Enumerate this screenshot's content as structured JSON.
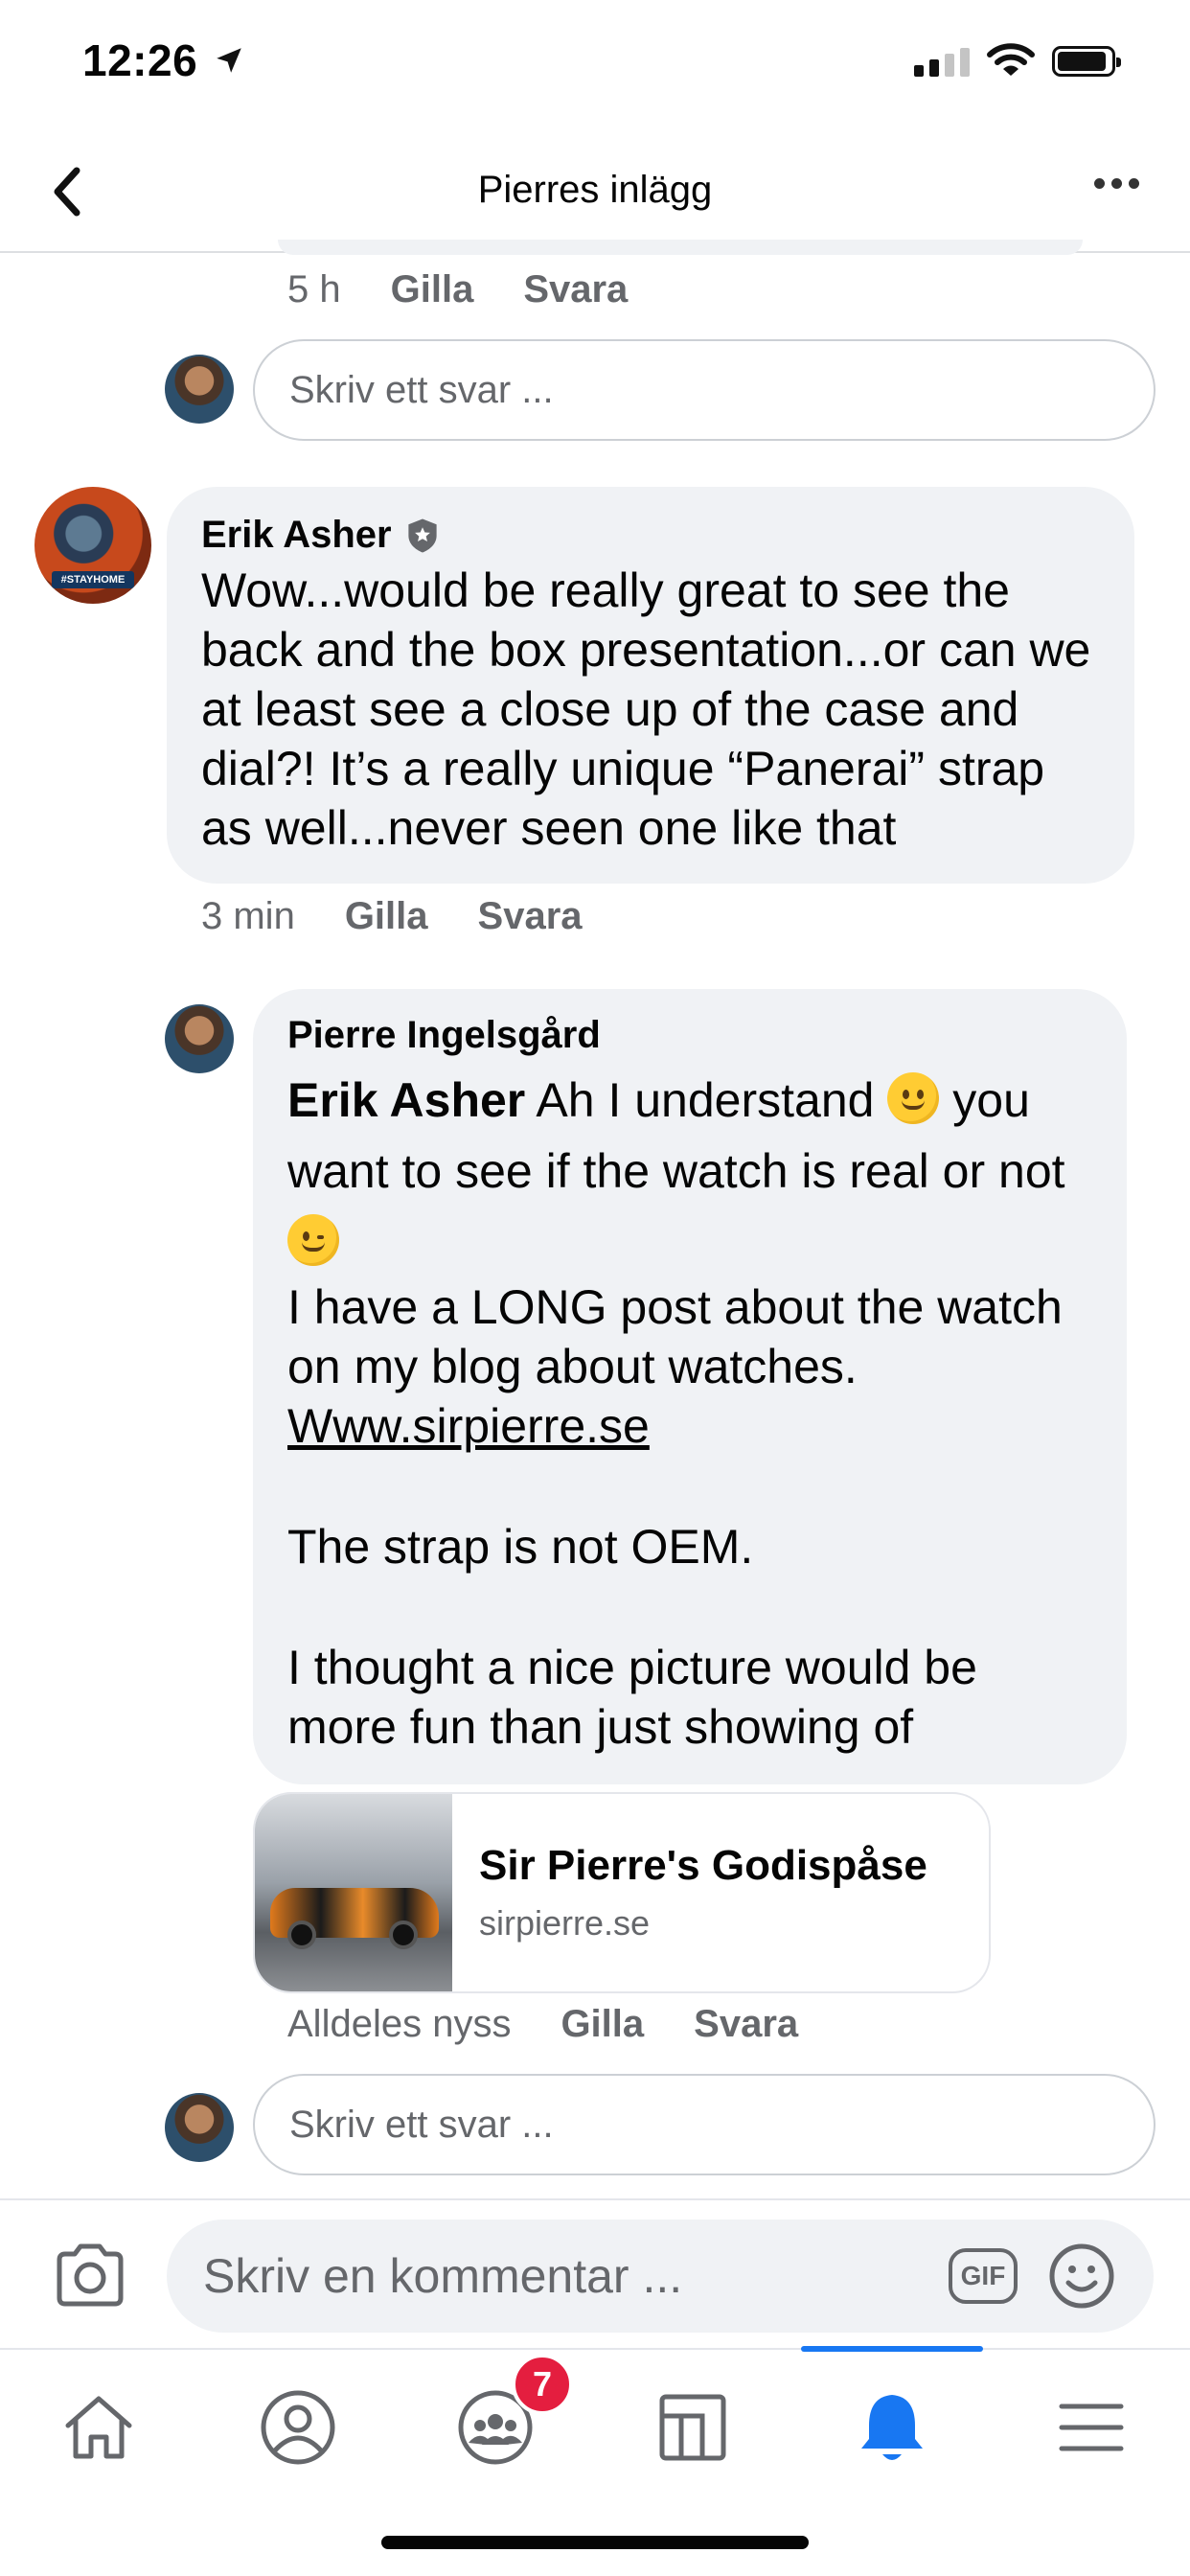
{
  "status_bar": {
    "time": "12:26"
  },
  "nav": {
    "title": "Pierres inlägg"
  },
  "top_reply": {
    "time": "5 h",
    "like": "Gilla",
    "reply": "Svara",
    "input_placeholder": "Skriv ett svar ..."
  },
  "comment_erik": {
    "author": "Erik Asher",
    "avatar_tag": "#STAYHOME",
    "text": "Wow...would be really great to see the back and the box presentation...or can we at least see a close up of the case and dial?!  It’s a really unique “Panerai” strap as well...never seen one like that",
    "time": "3 min",
    "like": "Gilla",
    "reply": "Svara"
  },
  "reply_pierre": {
    "author": "Pierre Ingelsgård",
    "mention": "Erik Asher",
    "line1_a": "Ah I understand",
    "line1_b": "you want to see if the watch is real or not",
    "line2": "I have a LONG post about the watch on my blog about watches.",
    "link_text": "Www.sirpierre.se",
    "line3": "The strap is not OEM.",
    "line4": "I thought a nice picture would be more fun than just showing of",
    "time": "Alldeles nyss",
    "like": "Gilla",
    "reply": "Svara"
  },
  "link_card": {
    "title": "Sir Pierre's Godispåse",
    "domain": "sirpierre.se"
  },
  "bottom_reply": {
    "input_placeholder": "Skriv ett svar ..."
  },
  "composer": {
    "placeholder": "Skriv en kommentar ...",
    "gif_label": "GIF"
  },
  "tab_bar": {
    "items": [
      "home-icon",
      "profile-icon",
      "groups-icon",
      "pages-icon",
      "notifications-icon",
      "menu-icon"
    ],
    "active": "notifications-icon",
    "groups_badge": "7"
  },
  "colors": {
    "accent": "#1877f2",
    "bubble": "#f0f2f5",
    "secondary_text": "#65676b",
    "badge": "#e41e3f"
  }
}
